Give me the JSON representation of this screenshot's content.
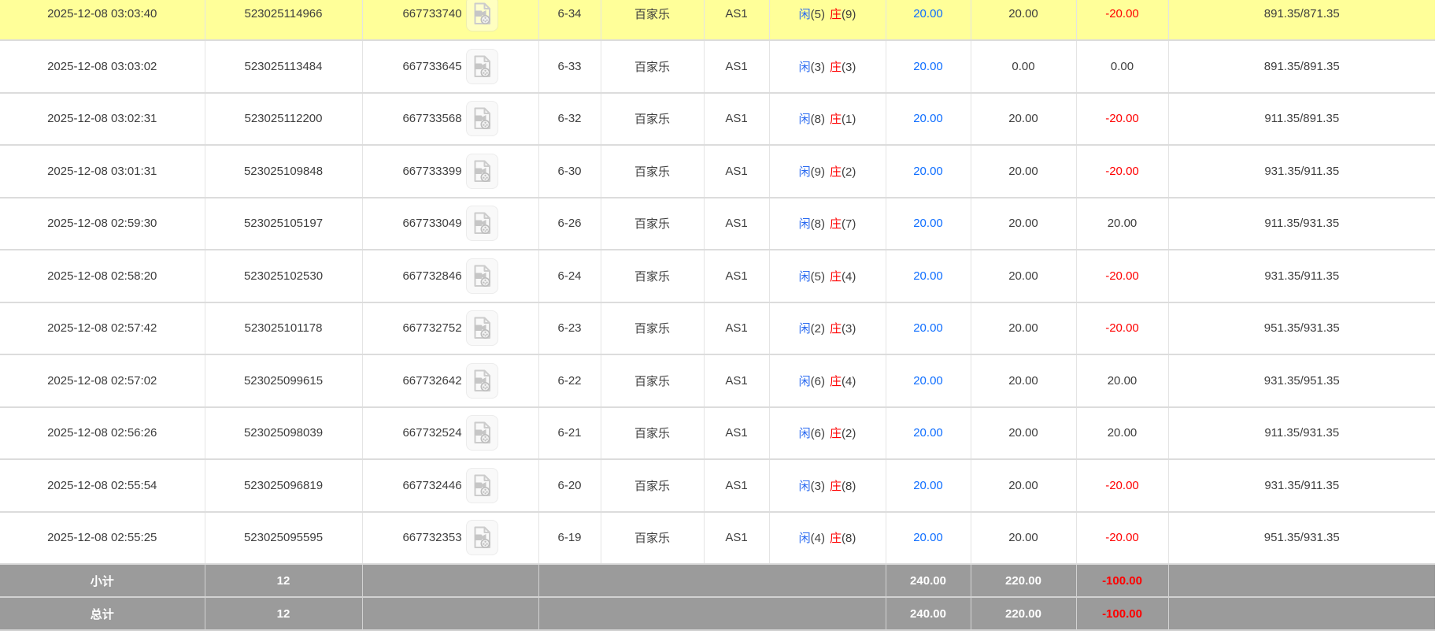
{
  "colors": {
    "row_highlight": "#ffff99",
    "summary_background": "#9b9b9b",
    "negative_red": "#ff0000",
    "amount_blue": "#0f6eff",
    "player_blue": "#2a6af0",
    "text": "#3e3e3e"
  },
  "icons": {
    "row_action": "video-replay-icon"
  },
  "table": {
    "rows": [
      {
        "time": "2025-12-08 03:03:40",
        "bet_no": "523025114966",
        "game_no": "667733740",
        "round": "6-34",
        "game_type": "百家乐",
        "table_label": "AS1",
        "xian": "闲",
        "xian_pts": "(5)",
        "zhuang": "庄",
        "zhuang_pts": "(9)",
        "bet_amount": "20.00",
        "valid_amount": "20.00",
        "win_loss": "-20.00",
        "balance": "891.35/871.35",
        "highlighted": true
      },
      {
        "time": "2025-12-08 03:03:02",
        "bet_no": "523025113484",
        "game_no": "667733645",
        "round": "6-33",
        "game_type": "百家乐",
        "table_label": "AS1",
        "xian": "闲",
        "xian_pts": "(3)",
        "zhuang": "庄",
        "zhuang_pts": "(3)",
        "bet_amount": "20.00",
        "valid_amount": "0.00",
        "win_loss": "0.00",
        "balance": "891.35/891.35",
        "highlighted": false
      },
      {
        "time": "2025-12-08 03:02:31",
        "bet_no": "523025112200",
        "game_no": "667733568",
        "round": "6-32",
        "game_type": "百家乐",
        "table_label": "AS1",
        "xian": "闲",
        "xian_pts": "(8)",
        "zhuang": "庄",
        "zhuang_pts": "(1)",
        "bet_amount": "20.00",
        "valid_amount": "20.00",
        "win_loss": "-20.00",
        "balance": "911.35/891.35",
        "highlighted": false
      },
      {
        "time": "2025-12-08 03:01:31",
        "bet_no": "523025109848",
        "game_no": "667733399",
        "round": "6-30",
        "game_type": "百家乐",
        "table_label": "AS1",
        "xian": "闲",
        "xian_pts": "(9)",
        "zhuang": "庄",
        "zhuang_pts": "(2)",
        "bet_amount": "20.00",
        "valid_amount": "20.00",
        "win_loss": "-20.00",
        "balance": "931.35/911.35",
        "highlighted": false
      },
      {
        "time": "2025-12-08 02:59:30",
        "bet_no": "523025105197",
        "game_no": "667733049",
        "round": "6-26",
        "game_type": "百家乐",
        "table_label": "AS1",
        "xian": "闲",
        "xian_pts": "(8)",
        "zhuang": "庄",
        "zhuang_pts": "(7)",
        "bet_amount": "20.00",
        "valid_amount": "20.00",
        "win_loss": "20.00",
        "balance": "911.35/931.35",
        "highlighted": false
      },
      {
        "time": "2025-12-08 02:58:20",
        "bet_no": "523025102530",
        "game_no": "667732846",
        "round": "6-24",
        "game_type": "百家乐",
        "table_label": "AS1",
        "xian": "闲",
        "xian_pts": "(5)",
        "zhuang": "庄",
        "zhuang_pts": "(4)",
        "bet_amount": "20.00",
        "valid_amount": "20.00",
        "win_loss": "-20.00",
        "balance": "931.35/911.35",
        "highlighted": false
      },
      {
        "time": "2025-12-08 02:57:42",
        "bet_no": "523025101178",
        "game_no": "667732752",
        "round": "6-23",
        "game_type": "百家乐",
        "table_label": "AS1",
        "xian": "闲",
        "xian_pts": "(2)",
        "zhuang": "庄",
        "zhuang_pts": "(3)",
        "bet_amount": "20.00",
        "valid_amount": "20.00",
        "win_loss": "-20.00",
        "balance": "951.35/931.35",
        "highlighted": false
      },
      {
        "time": "2025-12-08 02:57:02",
        "bet_no": "523025099615",
        "game_no": "667732642",
        "round": "6-22",
        "game_type": "百家乐",
        "table_label": "AS1",
        "xian": "闲",
        "xian_pts": "(6)",
        "zhuang": "庄",
        "zhuang_pts": "(4)",
        "bet_amount": "20.00",
        "valid_amount": "20.00",
        "win_loss": "20.00",
        "balance": "931.35/951.35",
        "highlighted": false
      },
      {
        "time": "2025-12-08 02:56:26",
        "bet_no": "523025098039",
        "game_no": "667732524",
        "round": "6-21",
        "game_type": "百家乐",
        "table_label": "AS1",
        "xian": "闲",
        "xian_pts": "(6)",
        "zhuang": "庄",
        "zhuang_pts": "(2)",
        "bet_amount": "20.00",
        "valid_amount": "20.00",
        "win_loss": "20.00",
        "balance": "911.35/931.35",
        "highlighted": false
      },
      {
        "time": "2025-12-08 02:55:54",
        "bet_no": "523025096819",
        "game_no": "667732446",
        "round": "6-20",
        "game_type": "百家乐",
        "table_label": "AS1",
        "xian": "闲",
        "xian_pts": "(3)",
        "zhuang": "庄",
        "zhuang_pts": "(8)",
        "bet_amount": "20.00",
        "valid_amount": "20.00",
        "win_loss": "-20.00",
        "balance": "931.35/911.35",
        "highlighted": false
      },
      {
        "time": "2025-12-08 02:55:25",
        "bet_no": "523025095595",
        "game_no": "667732353",
        "round": "6-19",
        "game_type": "百家乐",
        "table_label": "AS1",
        "xian": "闲",
        "xian_pts": "(4)",
        "zhuang": "庄",
        "zhuang_pts": "(8)",
        "bet_amount": "20.00",
        "valid_amount": "20.00",
        "win_loss": "-20.00",
        "balance": "951.35/931.35",
        "highlighted": false
      }
    ],
    "summary": {
      "subtotal": {
        "label": "小计",
        "count": "12",
        "bet_amount": "240.00",
        "valid_amount": "220.00",
        "win_loss": "-100.00"
      },
      "total": {
        "label": "总计",
        "count": "12",
        "bet_amount": "240.00",
        "valid_amount": "220.00",
        "win_loss": "-100.00"
      }
    }
  }
}
